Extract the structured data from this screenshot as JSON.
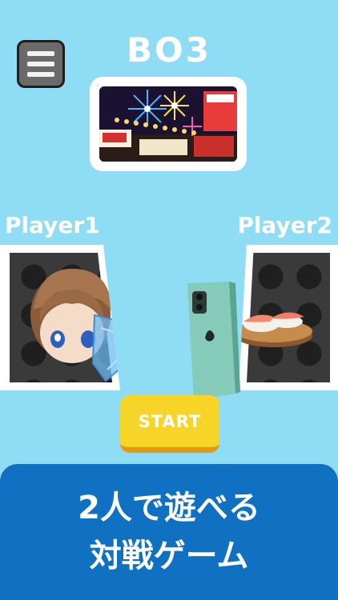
{
  "header": {
    "mode": "BO3"
  },
  "players": [
    {
      "name": "Player1"
    },
    {
      "name": "Player2"
    }
  ],
  "start_button": {
    "label": "START"
  },
  "banner": {
    "line1": "2人で遊べる",
    "line2": "対戦ゲーム"
  },
  "colors": {
    "background": "#8fdcf5",
    "banner": "#1070c2",
    "start_button": "#f7d428",
    "start_button_shadow": "#e39a12"
  },
  "icons": {
    "menu": "hamburger-menu-icon"
  }
}
